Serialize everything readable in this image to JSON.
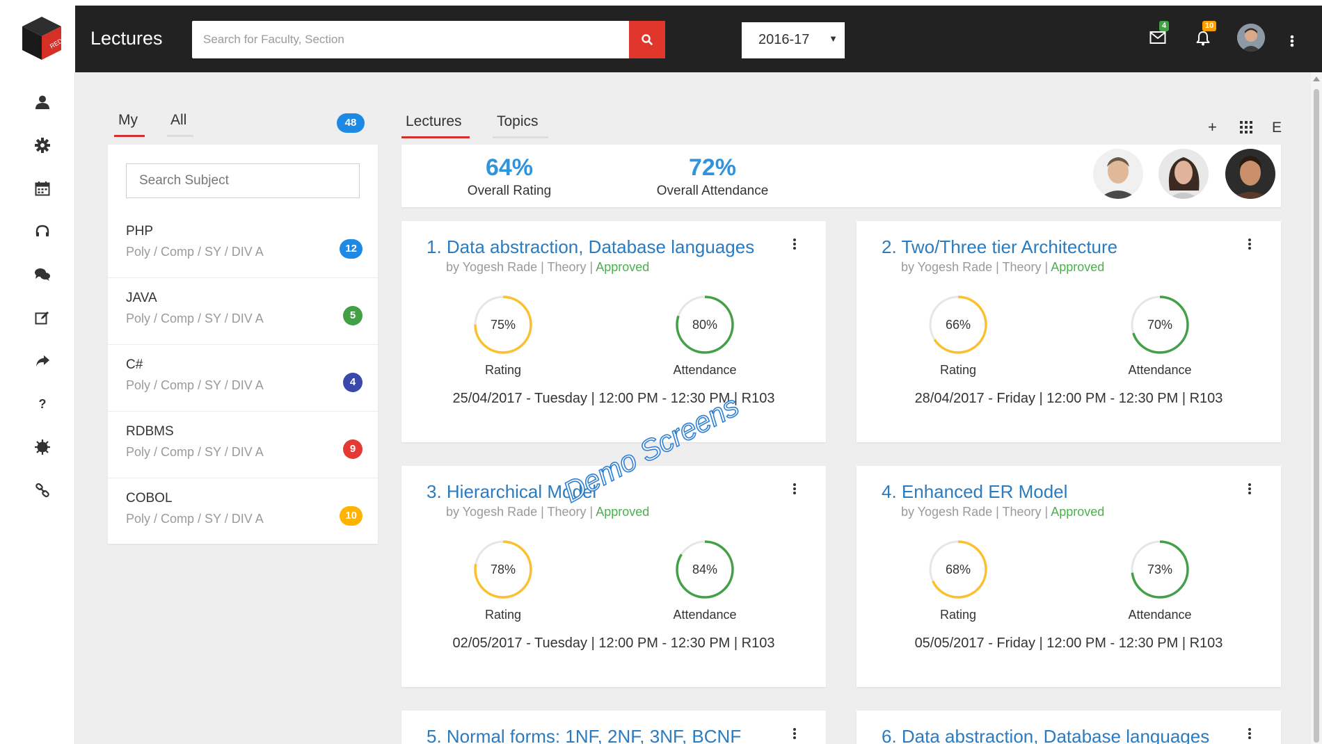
{
  "header": {
    "title": "Lectures",
    "search_placeholder": "Search for Faculty, Section",
    "year": "2016-17",
    "mail_count": "4",
    "notification_count": "10",
    "logo_text": "RED",
    "colors": {
      "bar": "#222222",
      "search_button": "#e0362c",
      "mail_badge": "#43a047",
      "notification_badge": "#ffa000"
    }
  },
  "sidebar": {
    "icons": [
      "user-icon",
      "gear-icon",
      "calendar-icon",
      "headset-icon",
      "chat-icon",
      "edit-icon",
      "share-icon",
      "help-icon",
      "bug-icon",
      "link-icon"
    ]
  },
  "subjects_panel": {
    "tabs": [
      {
        "label": "My",
        "active": true
      },
      {
        "label": "All",
        "active": false
      }
    ],
    "total_count": "48",
    "search_placeholder": "Search Subject",
    "items": [
      {
        "name": "PHP",
        "path": "Poly / Comp / SY / DIV A",
        "count": "12",
        "color": "#1e88e5"
      },
      {
        "name": "JAVA",
        "path": "Poly / Comp / SY / DIV A",
        "count": "5",
        "color": "#43a047"
      },
      {
        "name": "C#",
        "path": "Poly / Comp / SY / DIV A",
        "count": "4",
        "color": "#3949ab"
      },
      {
        "name": "RDBMS",
        "path": "Poly / Comp / SY / DIV A",
        "count": "9",
        "color": "#e53935"
      },
      {
        "name": "COBOL",
        "path": "Poly / Comp / SY / DIV A",
        "count": "10",
        "color": "#ffb300"
      }
    ]
  },
  "main": {
    "tabs": [
      {
        "label": "Lectures",
        "active": true
      },
      {
        "label": "Topics",
        "active": false
      }
    ],
    "tools": {
      "add": "+",
      "grid": "grid-icon",
      "export": "E"
    },
    "stats": {
      "overall_rating": "64%",
      "overall_rating_label": "Overall Rating",
      "overall_attendance": "72%",
      "overall_attendance_label": "Overall Attendance"
    },
    "faculty_avatars": [
      "faculty-avatar-1",
      "faculty-avatar-2",
      "faculty-avatar-3"
    ],
    "lectures": [
      {
        "title": "1. Data abstraction, Database languages",
        "by": "by Yogesh Rade | Theory | ",
        "status": "Approved",
        "rating": "75%",
        "rating_value": 75,
        "rating_label": "Rating",
        "attendance": "80%",
        "attendance_value": 80,
        "attendance_label": "Attendance",
        "schedule": "25/04/2017 - Tuesday | 12:00 PM - 12:30 PM | R103"
      },
      {
        "title": "2. Two/Three tier Architecture",
        "by": "by Yogesh Rade | Theory | ",
        "status": "Approved",
        "rating": "66%",
        "rating_value": 66,
        "rating_label": "Rating",
        "attendance": "70%",
        "attendance_value": 70,
        "attendance_label": "Attendance",
        "schedule": "28/04/2017 - Friday | 12:00 PM - 12:30 PM | R103"
      },
      {
        "title": "3. Hierarchical Model",
        "by": "by Yogesh Rade | Theory | ",
        "status": "Approved",
        "rating": "78%",
        "rating_value": 78,
        "rating_label": "Rating",
        "attendance": "84%",
        "attendance_value": 84,
        "attendance_label": "Attendance",
        "schedule": "02/05/2017 - Tuesday | 12:00 PM - 12:30 PM | R103"
      },
      {
        "title": "4. Enhanced ER Model",
        "by": "by Yogesh Rade | Theory | ",
        "status": "Approved",
        "rating": "68%",
        "rating_value": 68,
        "rating_label": "Rating",
        "attendance": "73%",
        "attendance_value": 73,
        "attendance_label": "Attendance",
        "schedule": "05/05/2017 - Friday | 12:00 PM - 12:30 PM | R103"
      },
      {
        "title": "5. Normal forms: 1NF, 2NF, 3NF, BCNF"
      },
      {
        "title": "6. Data abstraction, Database languages"
      }
    ],
    "ring_colors": {
      "rating": "#fbc02d",
      "attendance": "#43a047",
      "track": "#e6e6e6"
    }
  },
  "watermark": "Demo Screens"
}
